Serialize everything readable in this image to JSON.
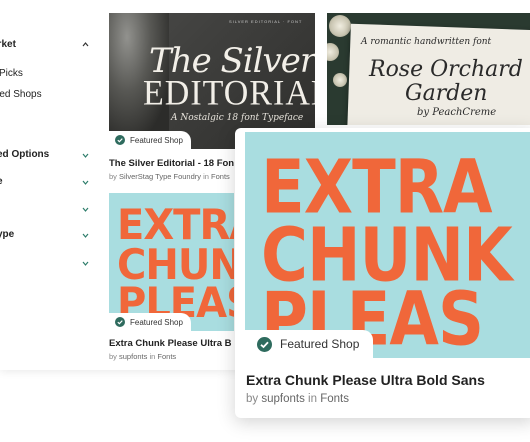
{
  "sidebar": {
    "items": [
      {
        "label": "arket",
        "chevron": "up",
        "bold": true
      },
      {
        "label": "Picks",
        "chevron": "",
        "bold": false
      },
      {
        "label": "red Shops",
        "chevron": "",
        "bold": false
      },
      {
        "label": "ed Options",
        "chevron": "down",
        "bold": true
      },
      {
        "label": "e",
        "chevron": "down",
        "bold": true
      },
      {
        "label": "",
        "chevron": "down",
        "bold": true
      },
      {
        "label": "ype",
        "chevron": "down",
        "bold": true
      },
      {
        "label": "",
        "chevron": "down",
        "bold": true
      }
    ]
  },
  "cards": [
    {
      "preview": {
        "line0": "SILVER EDITORIAL  ·  FONT",
        "line1": "The Silver",
        "line2": "EDITORIAL",
        "line3": "A Nostalgic 18 font Typeface"
      },
      "badge": "Featured Shop",
      "title": "The Silver Editorial - 18 Fon",
      "by": "by",
      "shop": "SilverStag Type Foundry",
      "in": "in",
      "category": "Fonts"
    },
    {
      "preview": {
        "line1": "A romantic handwritten font",
        "line2": "Rose Orchard",
        "line3": "Garden",
        "line4": "by PeachCreme"
      }
    },
    {
      "preview": {
        "line1": "EXTRA",
        "line2": "CHUNK",
        "line3": "PLEAS"
      },
      "badge": "Featured Shop",
      "title": "Extra Chunk Please Ultra B",
      "by": "by",
      "shop": "supfonts",
      "in": "in",
      "category": "Fonts"
    }
  ],
  "overlay": {
    "preview": {
      "line1": "EXTRA",
      "line2": "CHUNK",
      "line3": "PLEAS"
    },
    "badge": "Featured Shop",
    "title": "Extra Chunk Please Ultra Bold Sans",
    "by": "by",
    "shop": "supfonts",
    "in": "in",
    "category": "Fonts"
  },
  "colors": {
    "accent": "#2e6b5e",
    "chunk_bg": "#a9dde0",
    "chunk_text": "#f0673a"
  },
  "icons": {
    "chevron": "chevron-icon",
    "badge": "check-badge-icon"
  }
}
